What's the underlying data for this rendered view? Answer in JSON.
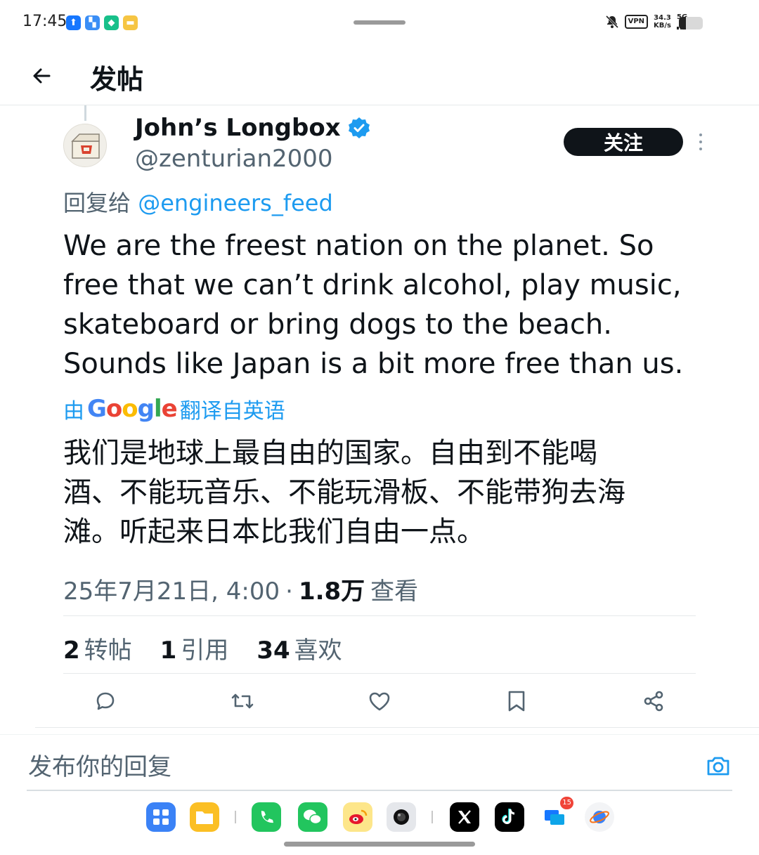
{
  "status_bar": {
    "time": "17:45",
    "vpn": "VPN",
    "speed_value": "34.3",
    "speed_unit": "KB/s",
    "network": "5G",
    "battery_level": 0.3
  },
  "header": {
    "title": "发帖"
  },
  "tweet": {
    "display_name": "John’s Longbox",
    "handle": "@zenturian2000",
    "follow_label": "关注",
    "reply_prefix": "回复给",
    "reply_mention": "@engineers_feed",
    "text_lines": [
      "We are the freest nation on the planet. So",
      "free that we can’t drink alcohol, play music,",
      "skateboard or bring dogs to the beach.",
      "Sounds like Japan is a bit more free than us."
    ],
    "translated_by_prefix": "由",
    "translated_by_brand": "Google",
    "translated_by_suffix": "翻译自英语",
    "translated_lines": [
      "我们是地球上最自由的国家。自由到不能喝",
      "酒、不能玩音乐、不能玩滑板、不能带狗去海",
      "滩。听起来日本比我们自由一点。"
    ],
    "timestamp": "25年7月21日, 4:00",
    "separator": "·",
    "views_count": "1.8万",
    "views_label": "查看",
    "stats": {
      "reposts_count": "2",
      "reposts_label": "转帖",
      "quotes_count": "1",
      "quotes_label": "引用",
      "likes_count": "34",
      "likes_label": "喜欢"
    }
  },
  "composer": {
    "placeholder": "发布你的回复"
  },
  "dock": {
    "messages_badge": "15"
  },
  "colors": {
    "accent": "#1d9bf0",
    "text_primary": "#0f1419",
    "text_secondary": "#536471",
    "follow_bg": "#0f1419"
  }
}
